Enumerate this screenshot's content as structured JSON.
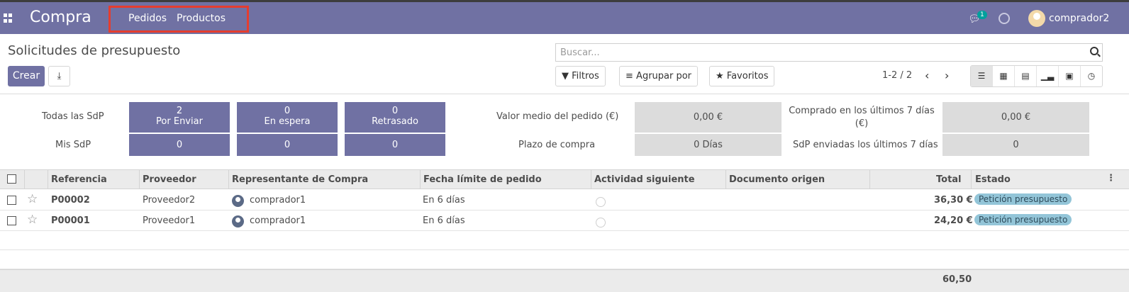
{
  "navbar": {
    "brand": "Compra",
    "menu": [
      "Pedidos",
      "Productos"
    ],
    "chat_badge": "1",
    "user": "comprador2"
  },
  "page": {
    "title": "Solicitudes de presupuesto",
    "create_label": "Crear",
    "search_placeholder": "Buscar...",
    "filters_label": "Filtros",
    "group_label": "Agrupar por",
    "favorites_label": "Favoritos",
    "pager": "1-2 / 2"
  },
  "dashboard": {
    "row_labels": [
      "Todas las SdP",
      "Mis SdP"
    ],
    "tiles_top": [
      {
        "count": "2",
        "label": "Por Enviar"
      },
      {
        "count": "0",
        "label": "En espera"
      },
      {
        "count": "0",
        "label": "Retrasado"
      }
    ],
    "tiles_bottom": [
      "0",
      "0",
      "0"
    ],
    "stats": [
      {
        "label": "Valor medio del pedido (€)",
        "value": "0,00 €"
      },
      {
        "label": "Plazo de compra",
        "value": "0  Días"
      },
      {
        "label": "Comprado en los últimos 7 días (€)",
        "value": "0,00 €"
      },
      {
        "label": "SdP enviadas los últimos 7 días",
        "value": "0"
      }
    ]
  },
  "table": {
    "headers": [
      "Referencia",
      "Proveedor",
      "Representante de Compra",
      "Fecha límite de pedido",
      "Actividad siguiente",
      "Documento origen",
      "Total",
      "Estado"
    ],
    "rows": [
      {
        "ref": "P00002",
        "vendor": "Proveedor2",
        "buyer": "comprador1",
        "deadline": "En 6 días",
        "total": "36,30 €",
        "status": "Petición presupuesto"
      },
      {
        "ref": "P00001",
        "vendor": "Proveedor1",
        "buyer": "comprador1",
        "deadline": "En 6 días",
        "total": "24,20 €",
        "status": "Petición presupuesto"
      }
    ],
    "footer_total": "60,50"
  }
}
